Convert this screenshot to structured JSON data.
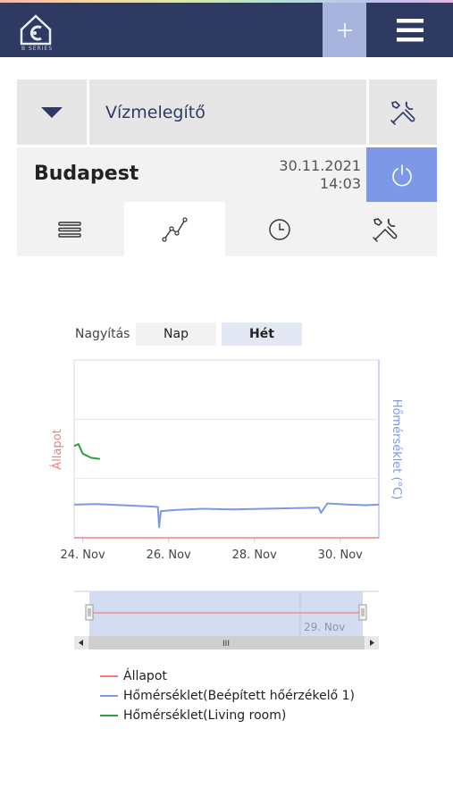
{
  "header": {
    "logo_icon": "house-logo-icon",
    "logo_subtext": "B SERIES",
    "plus_icon": "plus-icon",
    "menu_icon": "hamburger-menu-icon"
  },
  "device": {
    "name": "Vízmelegítő",
    "dropdown_icon": "triangle-down-icon",
    "settings_icon": "tools-icon"
  },
  "location": {
    "name": "Budapest",
    "date": "30.11.2021",
    "time": "14:03",
    "power_icon": "power-icon"
  },
  "tabs": [
    {
      "name": "list",
      "icon": "list-icon",
      "active": false
    },
    {
      "name": "chart",
      "icon": "line-chart-icon",
      "active": true
    },
    {
      "name": "schedule",
      "icon": "clock-icon",
      "active": false
    },
    {
      "name": "settings",
      "icon": "tools-icon",
      "active": false
    }
  ],
  "zoom": {
    "label": "Nagyítás",
    "day": "Nap",
    "week": "Hét"
  },
  "colors": {
    "header": "#2f3a63",
    "accent": "#7d98e6",
    "allapot": "#f08080",
    "homerseklet_1": "#7d98e6",
    "homerseklet_living": "#2e9e3e"
  },
  "chart_data": {
    "type": "line",
    "y_left_label": "Állapot",
    "y_right_label": "Hőmérséklet (°C)",
    "x_ticks": [
      "24. Nov",
      "26. Nov",
      "28. Nov",
      "30. Nov"
    ],
    "x_range_days": [
      23.8,
      30.9
    ],
    "navigator_label": "29. Nov",
    "scrollbar_grip": "III",
    "series": [
      {
        "name": "Állapot",
        "color": "#f08080",
        "points": [
          [
            23.8,
            0
          ],
          [
            30.9,
            0
          ]
        ]
      },
      {
        "name": "Hőmérséklet(Beépített hőérzékelő 1)",
        "color": "#7d98e6",
        "points": [
          [
            23.8,
            0.56
          ],
          [
            24.3,
            0.57
          ],
          [
            24.9,
            0.55
          ],
          [
            25.5,
            0.53
          ],
          [
            25.75,
            0.52
          ],
          [
            25.78,
            0.18
          ],
          [
            25.82,
            0.45
          ],
          [
            26.2,
            0.47
          ],
          [
            26.8,
            0.49
          ],
          [
            27.5,
            0.48
          ],
          [
            28.2,
            0.49
          ],
          [
            29.0,
            0.5
          ],
          [
            29.5,
            0.51
          ],
          [
            29.55,
            0.42
          ],
          [
            29.7,
            0.58
          ],
          [
            30.2,
            0.56
          ],
          [
            30.6,
            0.55
          ],
          [
            30.9,
            0.56
          ]
        ]
      },
      {
        "name": "Hőmérséklet(Living room)",
        "color": "#2e9e3e",
        "points": [
          [
            23.8,
            1.55
          ],
          [
            23.9,
            1.58
          ],
          [
            24.0,
            1.42
          ],
          [
            24.2,
            1.35
          ],
          [
            24.4,
            1.33
          ]
        ]
      }
    ],
    "grid": true,
    "legend_position": "bottom"
  }
}
